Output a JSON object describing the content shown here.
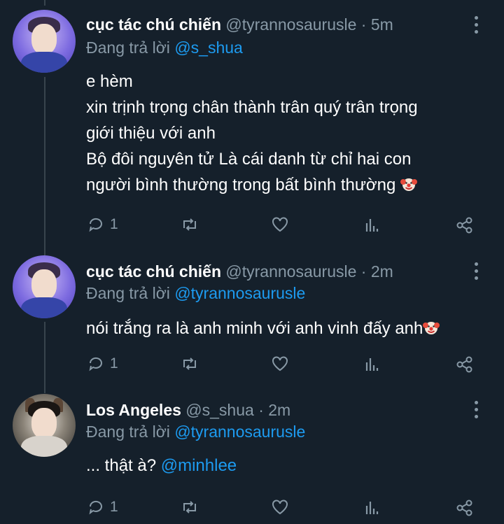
{
  "tweets": [
    {
      "author_name": "cục tác chú chiến",
      "handle": "@tyrannosaurusle",
      "time": "· 5m",
      "replying_prefix": "Đang trả lời",
      "replying_to": "@s_shua",
      "lines": [
        "e hèm",
        "xin trịnh trọng chân thành trân quý trân trọng",
        "giới thiệu với anh",
        "Bộ đôi nguyên tử Là cái danh từ chỉ hai con",
        "người bình thường trong bất bình thường"
      ],
      "emoji": "clown-face",
      "reply_count": "1"
    },
    {
      "author_name": "cục tác chú chiến",
      "handle": "@tyrannosaurusle",
      "time": "· 2m",
      "replying_prefix": "Đang trả lời",
      "replying_to": "@tyrannosaurusle",
      "lines": [
        "nói trắng ra là anh minh với anh vinh đấy anh"
      ],
      "emoji": "clown-face",
      "reply_count": "1"
    },
    {
      "author_name": "Los Angeles",
      "handle": "@s_shua",
      "time": "· 2m",
      "replying_prefix": "Đang trả lời",
      "replying_to": "@tyrannosaurusle",
      "text_prefix": "... thật à? ",
      "text_mention": "@minhlee",
      "reply_count": "1"
    }
  ],
  "colors": {
    "background": "#15202b",
    "text": "#ffffff",
    "muted": "#8899a6",
    "link": "#1d9bf0",
    "thread_line": "#38444d"
  },
  "icons": [
    "reply-icon",
    "retweet-icon",
    "like-icon",
    "analytics-icon",
    "share-icon",
    "more-options-icon"
  ]
}
